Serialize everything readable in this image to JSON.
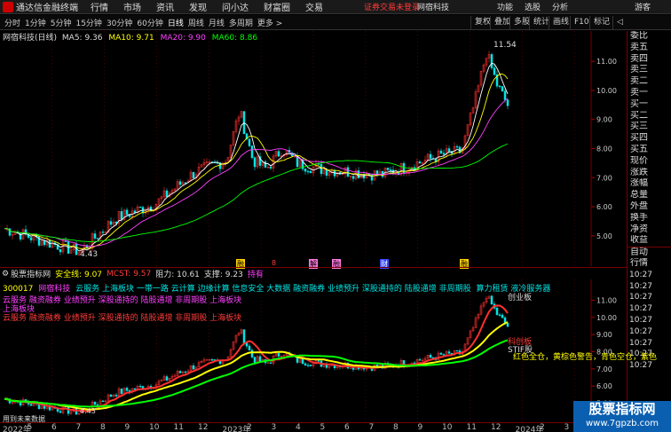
{
  "topbar": {
    "app_name": "通达信金融终端",
    "menus": [
      "行情",
      "市场",
      "资讯",
      "发现",
      "问小达",
      "财富圈",
      "交易"
    ],
    "notice": "证券交易未登录",
    "broker": "网宿科技",
    "links": [
      "功能",
      "选股",
      "分析"
    ],
    "guest": "游客"
  },
  "period_bar": {
    "periods": [
      "分时",
      "1分钟",
      "5分钟",
      "15分钟",
      "30分钟",
      "60分钟",
      "日线",
      "周线",
      "月线",
      "多周期",
      "更多 >"
    ],
    "active": "日线",
    "tools": [
      "复权",
      "叠加",
      "多股",
      "统计",
      "画线",
      "F10",
      "标记",
      "◁"
    ]
  },
  "main_chart": {
    "stock_title": "网宿科技(日线)",
    "ma5_label": "MA5: 9.36",
    "ma10_label": "MA10: 9.71",
    "ma20_label": "MA20: 9.90",
    "ma60_label": "MA60: 8.86",
    "price_ticks": [
      "11.00",
      "10.00",
      "9.00",
      "8.00",
      "7.00",
      "6.00",
      "5.00"
    ],
    "high_label": "11.54",
    "low_label": "4.43",
    "event_labels": [
      "融",
      "8",
      "解",
      "融",
      "财",
      "融"
    ]
  },
  "quote_panel": {
    "items": [
      "委比",
      "卖五",
      "卖四",
      "卖三",
      "卖二",
      "卖一",
      "买一",
      "买二",
      "买三",
      "买四",
      "买五",
      "现价",
      "涨跌",
      "涨幅",
      "总量",
      "外盘",
      "换手",
      "净资",
      "收益"
    ],
    "ticks_title": [
      "自动",
      "行情"
    ],
    "ticks": [
      "10:27",
      "10:27",
      "10:27",
      "10:27",
      "10:27",
      "10:27",
      "10:27",
      "10:27",
      "10:27"
    ]
  },
  "sub_chart": {
    "indicator_name": "股票指标网",
    "safe_line": "安全线: 9.07",
    "mcst": "MCST: 9.57",
    "resistance": "阻力: 10.61",
    "support": "支撑: 9.23",
    "hold": "持有",
    "code": "300017",
    "stock_name": "网宿科技",
    "concepts": "云服务   上海板块   一带一路  云计算  边缘计算  信息安全  大数据  融资融券  业绩预升  深股通持的  陆股通增  非周期股",
    "concepts_tail": "算力租赁  液冷服务器",
    "concepts_row2": "云服务   融资融券  业绩预升  深股通持的  陆股通增  非周期股  上海板块",
    "concepts_row3": "上海板块",
    "concepts_row4": "云服务  融资融券  业绩预升  深股通持的  陆股通增  非周期股  上海板块",
    "note_right": "创业板",
    "note_right2": "科创板",
    "note_right3": "STIF股",
    "message": "红色全仓，黄棕色警告，青色空仓，紫色",
    "watermark_text": "股票",
    "footer_text": "用到未来数据",
    "price_ticks": [
      "11.00",
      "10.00",
      "9.00",
      "8.00",
      "7.00",
      "6.00",
      "5.00"
    ],
    "low_tag": "4.43"
  },
  "date_axis": [
    "2022年",
    "5",
    "6",
    "7",
    "8",
    "9",
    "10",
    "11",
    "12",
    "2023年",
    "2",
    "3",
    "4",
    "5",
    "6",
    "7",
    "8",
    "9",
    "10",
    "11",
    "12",
    "2024年",
    "2",
    "3"
  ],
  "brand": {
    "line1": "股票指标网",
    "line2": "www.7gpzb.com"
  },
  "colors": {
    "ma5": "#ffffff",
    "ma10": "#ffff00",
    "ma20": "#ff40ff",
    "ma60": "#00ff00",
    "up": "#ff3030",
    "down": "#00e5e5",
    "grid": "#7a0000",
    "brand_bg": "#0b5fb0"
  }
}
